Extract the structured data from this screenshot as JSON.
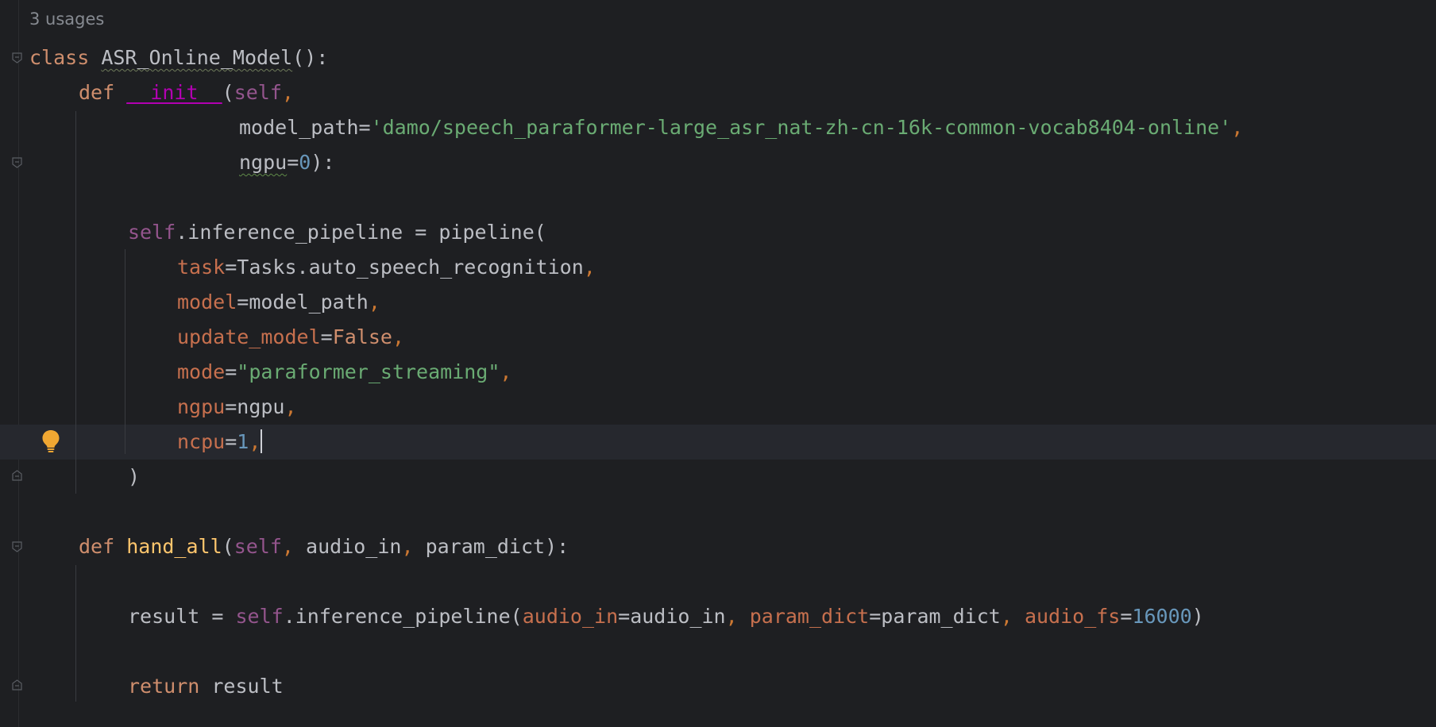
{
  "editor": {
    "usages_hint": "3 usages",
    "lines": {
      "l1_kw": "class",
      "l1_name": "ASR_Online_Model",
      "l1_rest": "():",
      "l2_kw": "def",
      "l2_fn": "__init__",
      "l2_open": "(",
      "l2_self": "self",
      "l2_comma": ",",
      "l3_param": "model_path",
      "l3_eq": "=",
      "l3_str": "'damo/speech_paraformer-large_asr_nat-zh-cn-16k-common-vocab8404-online'",
      "l3_comma": ",",
      "l4_param": "ngpu",
      "l4_eq": "=",
      "l4_num": "0",
      "l4_close": "):",
      "l6_self": "self",
      "l6_rest": ".inference_pipeline = pipeline(",
      "l7_key": "task",
      "l7_val": "=Tasks.auto_speech_recognition",
      "l7_comma": ",",
      "l8_key": "model",
      "l8_val": "=model_path",
      "l8_comma": ",",
      "l9_key": "update_model",
      "l9_eq": "=",
      "l9_val": "False",
      "l9_comma": ",",
      "l10_key": "mode",
      "l10_eq": "=",
      "l10_str": "\"paraformer_streaming\"",
      "l10_comma": ",",
      "l11_key": "ngpu",
      "l11_val": "=ngpu",
      "l11_comma": ",",
      "l12_key": "ncpu",
      "l12_eq": "=",
      "l12_num": "1",
      "l12_comma": ",",
      "l13": ")",
      "l15_kw": "def",
      "l15_fn": "hand_all",
      "l15_open": "(",
      "l15_self": "self",
      "l15_c1": ",",
      "l15_p1": " audio_in",
      "l15_c2": ",",
      "l15_p2": " param_dict):",
      "l17_a": "result = ",
      "l17_self": "self",
      "l17_b": ".inference_pipeline(",
      "l17_k1": "audio_in",
      "l17_v1": "=audio_in",
      "l17_c1": ",",
      "l17_k2": " param_dict",
      "l17_v2": "=param_dict",
      "l17_c2": ",",
      "l17_k3": " audio_fs",
      "l17_eq3": "=",
      "l17_n3": "16000",
      "l17_end": ")",
      "l19_kw": "return",
      "l19_rest": " result"
    }
  },
  "colors": {
    "background": "#1e1f22",
    "keyword": "#cf8e6d",
    "string": "#6aab73",
    "number": "#6897bb",
    "self": "#94558d",
    "named_arg": "#c7704e"
  },
  "icons": {
    "intention": "lightbulb-icon",
    "fold": "fold-marker-icon"
  }
}
